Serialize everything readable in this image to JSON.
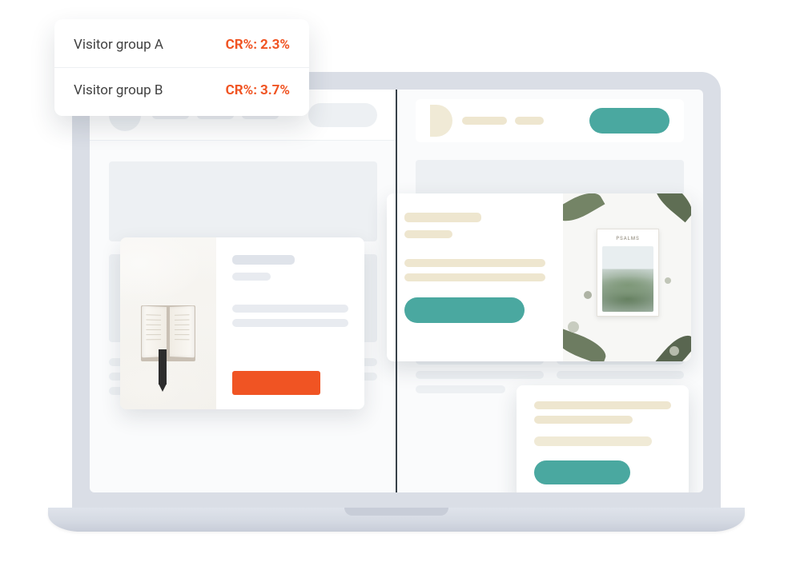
{
  "metrics": {
    "group_a": {
      "label": "Visitor group A",
      "cr_prefix": "CR%:",
      "cr_value": "2.3%"
    },
    "group_b": {
      "label": "Visitor group B",
      "cr_prefix": "CR%:",
      "cr_value": "3.7%"
    }
  },
  "variant_b": {
    "image_card_title": "PSALMS"
  },
  "colors": {
    "accent_orange": "#f05423",
    "accent_teal": "#4aa8a0",
    "cream": "#eee6cf",
    "placeholder_gray": "#edf0f3"
  }
}
